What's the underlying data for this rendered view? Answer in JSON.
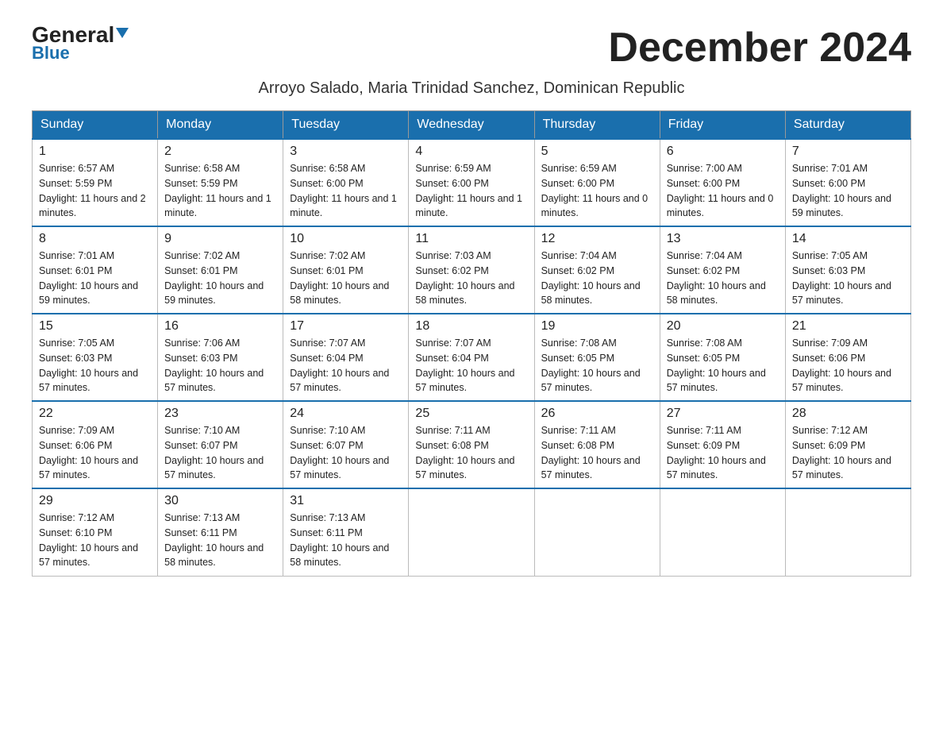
{
  "header": {
    "logo_general": "General",
    "logo_blue": "Blue",
    "month_title": "December 2024",
    "subtitle": "Arroyo Salado, Maria Trinidad Sanchez, Dominican Republic"
  },
  "days_of_week": [
    "Sunday",
    "Monday",
    "Tuesday",
    "Wednesday",
    "Thursday",
    "Friday",
    "Saturday"
  ],
  "weeks": [
    [
      {
        "day": "1",
        "sunrise": "6:57 AM",
        "sunset": "5:59 PM",
        "daylight": "11 hours and 2 minutes."
      },
      {
        "day": "2",
        "sunrise": "6:58 AM",
        "sunset": "5:59 PM",
        "daylight": "11 hours and 1 minute."
      },
      {
        "day": "3",
        "sunrise": "6:58 AM",
        "sunset": "6:00 PM",
        "daylight": "11 hours and 1 minute."
      },
      {
        "day": "4",
        "sunrise": "6:59 AM",
        "sunset": "6:00 PM",
        "daylight": "11 hours and 1 minute."
      },
      {
        "day": "5",
        "sunrise": "6:59 AM",
        "sunset": "6:00 PM",
        "daylight": "11 hours and 0 minutes."
      },
      {
        "day": "6",
        "sunrise": "7:00 AM",
        "sunset": "6:00 PM",
        "daylight": "11 hours and 0 minutes."
      },
      {
        "day": "7",
        "sunrise": "7:01 AM",
        "sunset": "6:00 PM",
        "daylight": "10 hours and 59 minutes."
      }
    ],
    [
      {
        "day": "8",
        "sunrise": "7:01 AM",
        "sunset": "6:01 PM",
        "daylight": "10 hours and 59 minutes."
      },
      {
        "day": "9",
        "sunrise": "7:02 AM",
        "sunset": "6:01 PM",
        "daylight": "10 hours and 59 minutes."
      },
      {
        "day": "10",
        "sunrise": "7:02 AM",
        "sunset": "6:01 PM",
        "daylight": "10 hours and 58 minutes."
      },
      {
        "day": "11",
        "sunrise": "7:03 AM",
        "sunset": "6:02 PM",
        "daylight": "10 hours and 58 minutes."
      },
      {
        "day": "12",
        "sunrise": "7:04 AM",
        "sunset": "6:02 PM",
        "daylight": "10 hours and 58 minutes."
      },
      {
        "day": "13",
        "sunrise": "7:04 AM",
        "sunset": "6:02 PM",
        "daylight": "10 hours and 58 minutes."
      },
      {
        "day": "14",
        "sunrise": "7:05 AM",
        "sunset": "6:03 PM",
        "daylight": "10 hours and 57 minutes."
      }
    ],
    [
      {
        "day": "15",
        "sunrise": "7:05 AM",
        "sunset": "6:03 PM",
        "daylight": "10 hours and 57 minutes."
      },
      {
        "day": "16",
        "sunrise": "7:06 AM",
        "sunset": "6:03 PM",
        "daylight": "10 hours and 57 minutes."
      },
      {
        "day": "17",
        "sunrise": "7:07 AM",
        "sunset": "6:04 PM",
        "daylight": "10 hours and 57 minutes."
      },
      {
        "day": "18",
        "sunrise": "7:07 AM",
        "sunset": "6:04 PM",
        "daylight": "10 hours and 57 minutes."
      },
      {
        "day": "19",
        "sunrise": "7:08 AM",
        "sunset": "6:05 PM",
        "daylight": "10 hours and 57 minutes."
      },
      {
        "day": "20",
        "sunrise": "7:08 AM",
        "sunset": "6:05 PM",
        "daylight": "10 hours and 57 minutes."
      },
      {
        "day": "21",
        "sunrise": "7:09 AM",
        "sunset": "6:06 PM",
        "daylight": "10 hours and 57 minutes."
      }
    ],
    [
      {
        "day": "22",
        "sunrise": "7:09 AM",
        "sunset": "6:06 PM",
        "daylight": "10 hours and 57 minutes."
      },
      {
        "day": "23",
        "sunrise": "7:10 AM",
        "sunset": "6:07 PM",
        "daylight": "10 hours and 57 minutes."
      },
      {
        "day": "24",
        "sunrise": "7:10 AM",
        "sunset": "6:07 PM",
        "daylight": "10 hours and 57 minutes."
      },
      {
        "day": "25",
        "sunrise": "7:11 AM",
        "sunset": "6:08 PM",
        "daylight": "10 hours and 57 minutes."
      },
      {
        "day": "26",
        "sunrise": "7:11 AM",
        "sunset": "6:08 PM",
        "daylight": "10 hours and 57 minutes."
      },
      {
        "day": "27",
        "sunrise": "7:11 AM",
        "sunset": "6:09 PM",
        "daylight": "10 hours and 57 minutes."
      },
      {
        "day": "28",
        "sunrise": "7:12 AM",
        "sunset": "6:09 PM",
        "daylight": "10 hours and 57 minutes."
      }
    ],
    [
      {
        "day": "29",
        "sunrise": "7:12 AM",
        "sunset": "6:10 PM",
        "daylight": "10 hours and 57 minutes."
      },
      {
        "day": "30",
        "sunrise": "7:13 AM",
        "sunset": "6:11 PM",
        "daylight": "10 hours and 58 minutes."
      },
      {
        "day": "31",
        "sunrise": "7:13 AM",
        "sunset": "6:11 PM",
        "daylight": "10 hours and 58 minutes."
      },
      null,
      null,
      null,
      null
    ]
  ]
}
